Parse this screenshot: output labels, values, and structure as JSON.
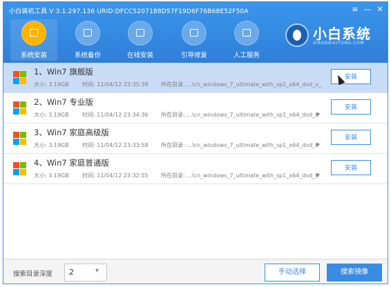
{
  "app": {
    "title": "小白装机工具 V 3.1.297.136 URID:DFCC5207188D57F19D6F76B68E52F50A",
    "controls": {
      "menu": "≡",
      "minimize": "—",
      "close": "✕"
    }
  },
  "nav": [
    {
      "label": "系统安装",
      "icon": "system-install-icon",
      "active": true
    },
    {
      "label": "系统备份",
      "icon": "system-backup-icon",
      "active": false
    },
    {
      "label": "在线安装",
      "icon": "online-install-icon",
      "active": false
    },
    {
      "label": "引导修复",
      "icon": "boot-repair-icon",
      "active": false
    },
    {
      "label": "人工服务",
      "icon": "support-chat-icon",
      "active": false
    }
  ],
  "brand": {
    "name": "小白系统",
    "url": "XIAOBAIXITONG.COM"
  },
  "systems": [
    {
      "title": "1、Win7 旗舰版",
      "size": "大小: 3.19GB",
      "time": "时间: 11/04/12 23:35:39",
      "path": "所在目录: ...\\cn_windows_7_ultimate_with_sp1_x64_dvd_u_",
      "action": "安装",
      "selected": true
    },
    {
      "title": "2、Win7 专业版",
      "size": "大小: 3.19GB",
      "time": "时间: 11/04/12 23:34:36",
      "path": "所在目录: ...\\cn_windows_7_ultimate_with_sp1_x64_dvd_u",
      "action": "安装",
      "selected": false
    },
    {
      "title": "3、Win7 家庭高级版",
      "size": "大小: 3.19GB",
      "time": "时间: 11/04/12 23:33:58",
      "path": "所在目录: ...\\cn_windows_7_ultimate_with_sp1_x64_dvd_u",
      "action": "安装",
      "selected": false
    },
    {
      "title": "4、Win7 家庭普通版",
      "size": "大小: 3.19GB",
      "time": "时间: 11/04/12 23:32:55",
      "path": "所在目录: ...\\cn_windows_7_ultimate_with_sp1_x64_dvd_u",
      "action": "安装",
      "selected": false
    }
  ],
  "footer": {
    "depth_label": "搜索目录深度",
    "depth_value": "2",
    "manual_label": "手动选择",
    "search_label": "搜索镜像"
  },
  "colors": {
    "accent": "#3b8be2",
    "header": "#3a8ee6",
    "selected_row": "#c8dcf5",
    "active_nav": "#ffb400"
  }
}
